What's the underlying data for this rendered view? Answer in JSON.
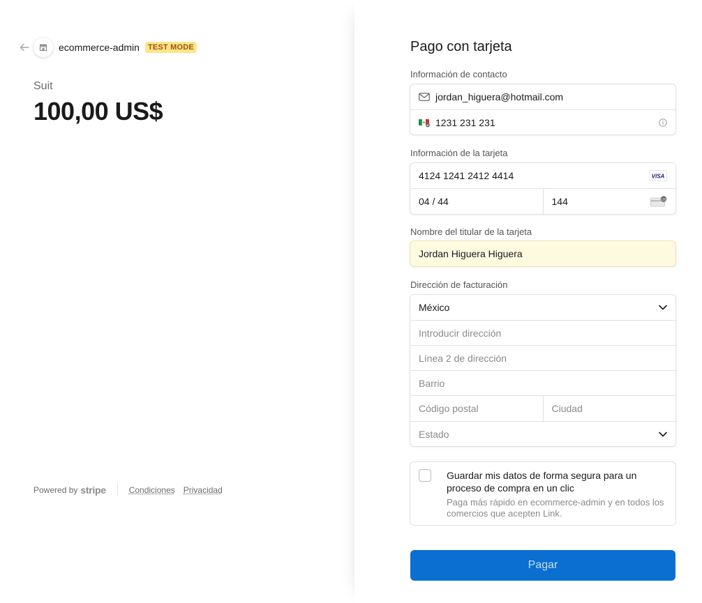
{
  "merchant": {
    "name": "ecommerce-admin",
    "test_badge": "TEST MODE"
  },
  "product": {
    "name": "Suit",
    "price": "100,00 US$"
  },
  "footer": {
    "powered_by": "Powered by",
    "brand": "stripe",
    "terms": "Condiciones",
    "privacy": "Privacidad"
  },
  "form": {
    "title": "Pago con tarjeta",
    "contact": {
      "label": "Información de contacto",
      "email": "jordan_higuera@hotmail.com",
      "phone": "1231 231 231"
    },
    "card": {
      "label": "Información de la tarjeta",
      "number": "4124 1241 2412 4414",
      "brand": "VISA",
      "expiry": "04 / 44",
      "cvc": "144"
    },
    "cardholder": {
      "label": "Nombre del titular de la tarjeta",
      "value": "Jordan Higuera Higuera"
    },
    "billing": {
      "label": "Dirección de facturación",
      "country": "México",
      "address1_placeholder": "Introducir dirección",
      "address2_placeholder": "Línea 2 de dirección",
      "neighborhood_placeholder": "Barrio",
      "postal_placeholder": "Código postal",
      "city_placeholder": "Ciudad",
      "state_placeholder": "Estado"
    },
    "save": {
      "title": "Guardar mis datos de forma segura para un proceso de compra en un clic",
      "description": "Paga más rápido en ecommerce-admin y en todos los comercios que acepten Link."
    },
    "pay_button": "Pagar"
  },
  "colors": {
    "accent": "#0a6fd1",
    "badge_bg": "#fde68a",
    "badge_text": "#a0520b",
    "autofill_bg": "#fefae0"
  }
}
